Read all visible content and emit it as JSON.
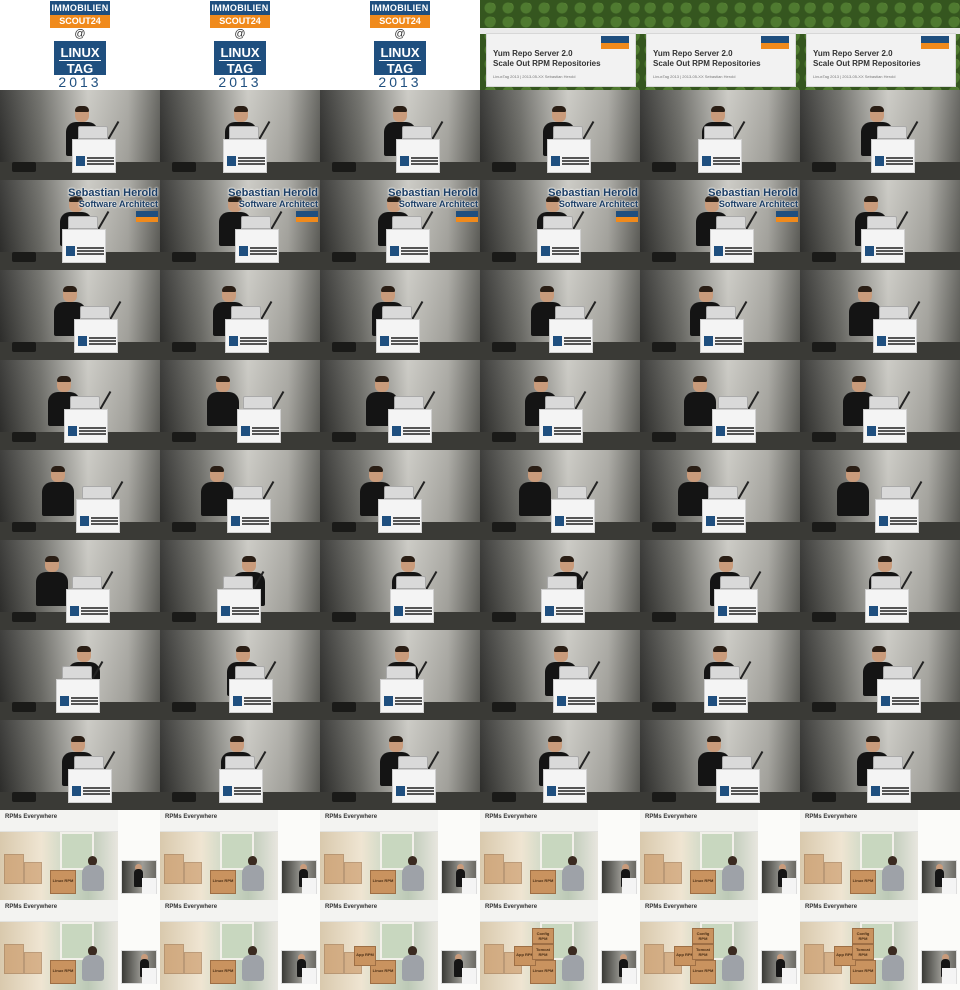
{
  "title_card": {
    "brand_line1": "IMMOBILIEN",
    "brand_line2": "SCOUT24",
    "at": "@",
    "event_line1": "LINUX",
    "event_line2": "TAG",
    "year": "2013"
  },
  "talk_slide": {
    "title_line1": "Yum Repo Server 2.0",
    "title_line2": "Scale Out RPM Repositories",
    "subtitle": "LinuxTag 2013 | 2013-05-XX Sebastian Herold"
  },
  "lower_third": {
    "name": "Sebastian Herold",
    "role": "Software Architect"
  },
  "rpm_slide": {
    "heading": "RPMs Everywhere",
    "box_linux": "Linux RPM",
    "box_config": "Config RPM",
    "box_tomcat": "Tomcat RPM",
    "box_app": "App RPM"
  },
  "colors": {
    "brand_blue": "#1f4f7f",
    "brand_orange": "#f08a1c",
    "lower_third_text": "#1b3e66"
  },
  "layout": {
    "rows": [
      [
        "title",
        "title",
        "title",
        "slide",
        "slide",
        "slide"
      ],
      [
        "stage",
        "stage",
        "stage",
        "stage",
        "stage",
        "stage"
      ],
      [
        "stage-name",
        "stage-name",
        "stage-name",
        "stage-name",
        "stage-name",
        "stage"
      ],
      [
        "stage",
        "stage",
        "stage",
        "stage",
        "stage",
        "stage"
      ],
      [
        "stage",
        "stage",
        "stage",
        "stage",
        "stage",
        "stage"
      ],
      [
        "stage",
        "stage",
        "stage",
        "stage",
        "stage",
        "stage"
      ],
      [
        "stage",
        "stage",
        "stage",
        "stage",
        "stage",
        "stage"
      ],
      [
        "stage",
        "stage",
        "stage",
        "stage",
        "stage",
        "stage"
      ],
      [
        "stage",
        "stage",
        "stage",
        "stage",
        "stage",
        "stage"
      ],
      [
        "rpm-1",
        "rpm-1",
        "rpm-1",
        "rpm-1",
        "rpm-1",
        "rpm-1"
      ],
      [
        "rpm-1",
        "rpm-1",
        "rpm-3",
        "rpm-4",
        "rpm-4",
        "rpm-4"
      ]
    ]
  }
}
